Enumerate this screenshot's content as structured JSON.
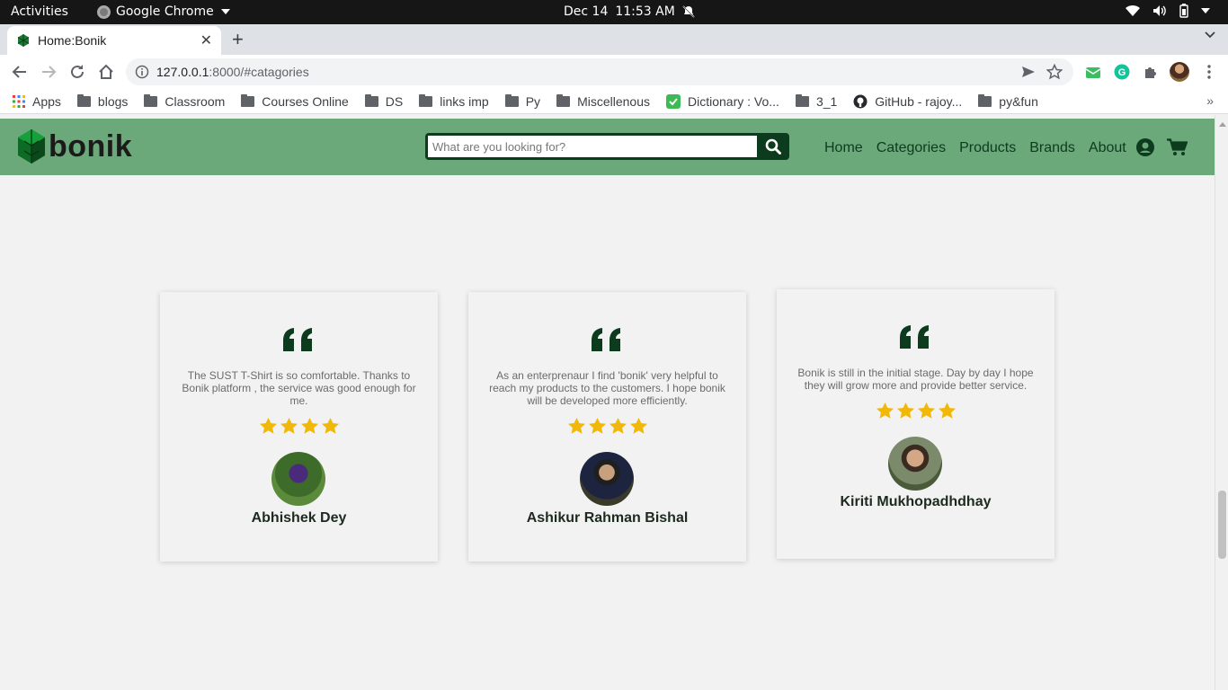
{
  "os_bar": {
    "activities": "Activities",
    "app_name": "Google Chrome",
    "date": "Dec 14",
    "time": "11:53 AM"
  },
  "tab": {
    "title": "Home:Bonik"
  },
  "address": {
    "host": "127.0.0.1",
    "rest": ":8000/#catagories"
  },
  "bookmarks": [
    {
      "label": "Apps",
      "icon": "apps-grid-icon"
    },
    {
      "label": "blogs",
      "icon": "folder-icon"
    },
    {
      "label": "Classroom",
      "icon": "folder-icon"
    },
    {
      "label": "Courses Online",
      "icon": "folder-icon"
    },
    {
      "label": "DS",
      "icon": "folder-icon"
    },
    {
      "label": "links imp",
      "icon": "folder-icon"
    },
    {
      "label": "Py",
      "icon": "folder-icon"
    },
    {
      "label": "Miscellenous",
      "icon": "folder-icon"
    },
    {
      "label": "Dictionary : Vo...",
      "icon": "check-icon"
    },
    {
      "label": "3_1",
      "icon": "folder-icon"
    },
    {
      "label": "GitHub - rajoy...",
      "icon": "github-icon"
    },
    {
      "label": "py&fun",
      "icon": "folder-icon"
    }
  ],
  "site": {
    "logo_text": "bonik",
    "search_placeholder": "What are you looking for?",
    "menu": [
      "Home",
      "Categories",
      "Products",
      "Brands",
      "About"
    ],
    "colors": {
      "nav_bg": "#6ba87a",
      "dark_green": "#0d3b1e",
      "star": "#f2b807"
    }
  },
  "testimonials": [
    {
      "text": "The SUST T-Shirt is so comfortable. Thanks to Bonik platform , the service was good enough for me.",
      "rating": 4,
      "name": "Abhishek Dey"
    },
    {
      "text": "As an enterprenaur I find 'bonik' very helpful to reach my products to the customers. I hope bonik will be developed more efficiently.",
      "rating": 4,
      "name": "Ashikur Rahman Bishal"
    },
    {
      "text": "Bonik is still in the initial stage. Day by day I hope they will grow more and provide better service.",
      "rating": 4,
      "name": "Kiriti Mukhopadhdhay"
    }
  ]
}
